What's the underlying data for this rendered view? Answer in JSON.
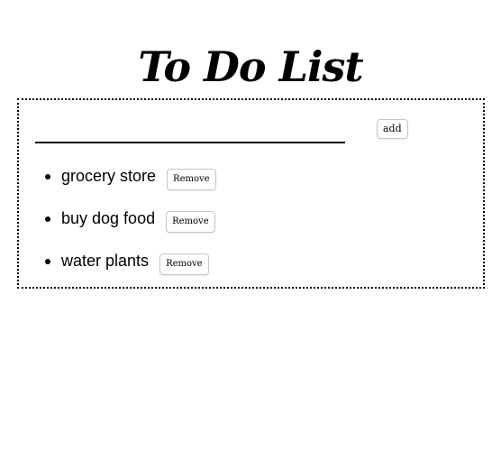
{
  "header": {
    "title": "To Do List"
  },
  "form": {
    "input_value": "",
    "add_label": "add"
  },
  "tasks": [
    {
      "text": "grocery store",
      "remove_label": "Remove"
    },
    {
      "text": "buy dog food",
      "remove_label": "Remove"
    },
    {
      "text": "water plants",
      "remove_label": "Remove"
    }
  ]
}
